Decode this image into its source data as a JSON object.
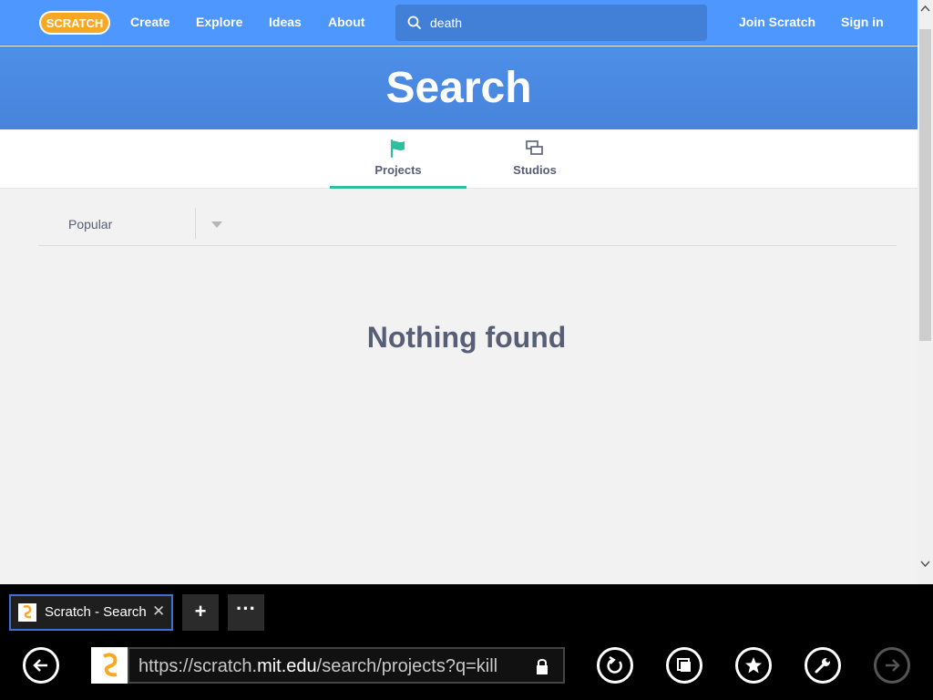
{
  "nav": {
    "logo_text": "SCRATCH",
    "links": [
      "Create",
      "Explore",
      "Ideas",
      "About"
    ],
    "search_value": "death",
    "join_label": "Join Scratch",
    "signin_label": "Sign in"
  },
  "banner": {
    "title": "Search"
  },
  "tabs": [
    {
      "label": "Projects",
      "icon": "flag-icon",
      "active": true
    },
    {
      "label": "Studios",
      "icon": "studios-icon",
      "active": false
    }
  ],
  "sort": {
    "selected": "Popular"
  },
  "results": {
    "empty_message": "Nothing found"
  },
  "browser": {
    "tab_title": "Scratch - Search",
    "url_prefix": "https://scratch.",
    "url_domain": "mit.edu",
    "url_path": "/search/projects?q=kill"
  },
  "colors": {
    "nav_blue": "#4d97ff",
    "banner_blue": "#4d8ae0",
    "tab_active": "#2dbf9e",
    "text": "#575e75"
  }
}
